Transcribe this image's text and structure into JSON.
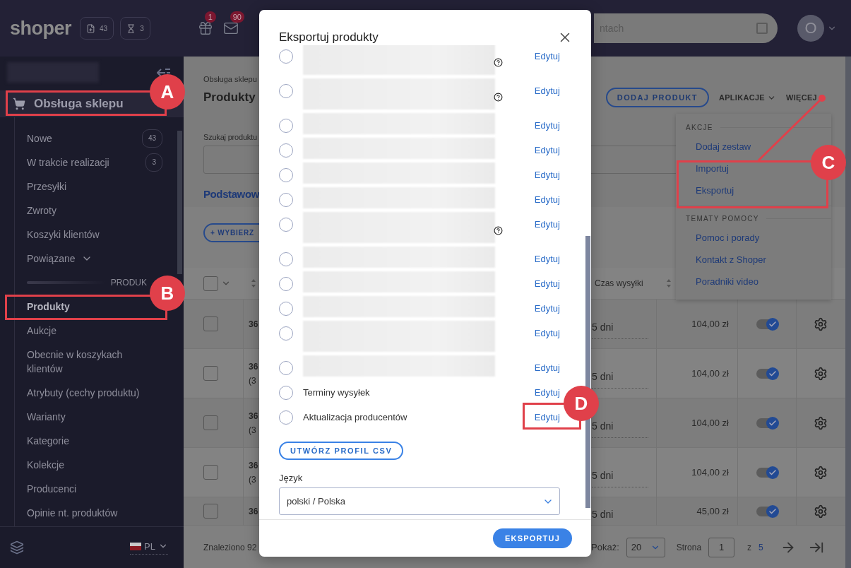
{
  "topbar": {
    "logo": "shoper",
    "counters": [
      {
        "kind": "file",
        "count": "43"
      },
      {
        "kind": "hourglass",
        "count": "3"
      }
    ],
    "notifications": [
      {
        "kind": "gift",
        "badge": "1"
      },
      {
        "kind": "mail",
        "badge": "90"
      }
    ],
    "search": {
      "placeholder": "ntach"
    },
    "avatar": {
      "initial": "O"
    }
  },
  "sidebar": {
    "section": "Obsługa sklepu",
    "items": [
      {
        "label": "Nowe",
        "count": "43"
      },
      {
        "label": "W trakcie realizacji",
        "count": "3"
      },
      {
        "label": "Przesyłki"
      },
      {
        "label": "Zwroty"
      },
      {
        "label": "Koszyki klientów"
      },
      {
        "label": "Powiązane",
        "expanded": false
      }
    ],
    "divider": "PRODUK",
    "product_items": [
      {
        "label": "Produkty",
        "selected": true
      },
      {
        "label": "Aukcje",
        "selected": false
      },
      {
        "label": "Obecnie w koszykach klientów",
        "selected": false
      },
      {
        "label": "Atrybuty (cechy produktu)",
        "selected": false
      },
      {
        "label": "Warianty",
        "selected": false
      },
      {
        "label": "Kategorie",
        "selected": false
      },
      {
        "label": "Kolekcje",
        "selected": false
      },
      {
        "label": "Producenci",
        "selected": false
      },
      {
        "label": "Opinie nt. produktów",
        "selected": false
      }
    ],
    "language": "PL"
  },
  "page": {
    "breadcrumb": "Obsługa sklepu",
    "title": "Produkty",
    "actions": [
      {
        "kind": "button",
        "label": "DODAJ PRODUKT"
      },
      {
        "kind": "dropdown",
        "label": "APLIKACJE"
      },
      {
        "kind": "menu",
        "label": "WIĘCEJ"
      }
    ],
    "search_label": "Szukaj produktu",
    "tab": "Podstawow",
    "select_button": "+ WYBIERZ",
    "table": {
      "columns": [
        {
          "label": "Czas wysyłki"
        }
      ],
      "select_all": {
        "checked": false
      },
      "rows": [
        {
          "checked": false,
          "code": "36",
          "shipping": "5 dni",
          "price": "104,00 zł",
          "active": true
        },
        {
          "checked": false,
          "code": "36",
          "note": "(3",
          "shipping": "5 dni",
          "price": "104,00 zł",
          "active": true
        },
        {
          "checked": false,
          "code": "36",
          "note": "(3",
          "shipping": "5 dni",
          "price": "104,00 zł",
          "active": true
        },
        {
          "checked": false,
          "code": "36",
          "note": "(3",
          "shipping": "5 dni",
          "price": "104,00 zł",
          "active": true
        },
        {
          "checked": false,
          "code": "36",
          "shipping": "5 dni",
          "price": "45,00 zł",
          "active": true
        }
      ]
    },
    "footer": {
      "found": "Znaleziono 92",
      "show_label": "Pokaż:",
      "per_page": "20",
      "page_label": "Strona",
      "page": "1",
      "of": "z",
      "pages": "5"
    }
  },
  "more_menu": {
    "sections": [
      {
        "heading": "AKCJE",
        "items": [
          "Dodaj zestaw",
          "Importuj",
          "Eksportuj"
        ]
      },
      {
        "heading": "TEMATY POMOCY",
        "items": [
          "Pomoc i porady",
          "Kontakt z Shoper",
          "Poradniki video"
        ]
      }
    ]
  },
  "modal": {
    "title": "Eksportuj produkty",
    "profiles": [
      {
        "kind": "blurred-long",
        "help": true,
        "selected": false,
        "action": "Edytuj"
      },
      {
        "kind": "blurred-long",
        "help": true,
        "selected": false,
        "action": "Edytuj"
      },
      {
        "kind": "blurred",
        "help": false,
        "selected": false,
        "action": "Edytuj"
      },
      {
        "kind": "blurred",
        "help": false,
        "selected": false,
        "action": "Edytuj"
      },
      {
        "kind": "blurred",
        "help": false,
        "selected": false,
        "action": "Edytuj"
      },
      {
        "kind": "blurred",
        "help": false,
        "selected": false,
        "action": "Edytuj"
      },
      {
        "kind": "blurred-long",
        "help": true,
        "selected": false,
        "action": "Edytuj"
      },
      {
        "kind": "blurred",
        "help": false,
        "selected": false,
        "action": "Edytuj"
      },
      {
        "kind": "blurred",
        "help": false,
        "selected": false,
        "action": "Edytuj"
      },
      {
        "kind": "blurred",
        "help": false,
        "selected": false,
        "action": "Edytuj"
      },
      {
        "kind": "blurred-long",
        "help": false,
        "selected": false,
        "action": "Edytuj"
      },
      {
        "kind": "blurred",
        "help": false,
        "selected": false,
        "action": "Edytuj"
      },
      {
        "kind": "named",
        "name": "Terminy wysyłek",
        "help": false,
        "selected": false,
        "action": "Edytuj"
      },
      {
        "kind": "named",
        "name": "Aktualizacja producentów",
        "help": false,
        "selected": false,
        "action": "Edytuj"
      }
    ],
    "create_button": "UTWÓRZ PROFIL CSV",
    "language_label": "Język",
    "language": "polski / Polska",
    "submit": "EKSPORTUJ"
  },
  "annotations": [
    {
      "label": "A"
    },
    {
      "label": "B"
    },
    {
      "label": "C"
    },
    {
      "label": "D"
    }
  ]
}
